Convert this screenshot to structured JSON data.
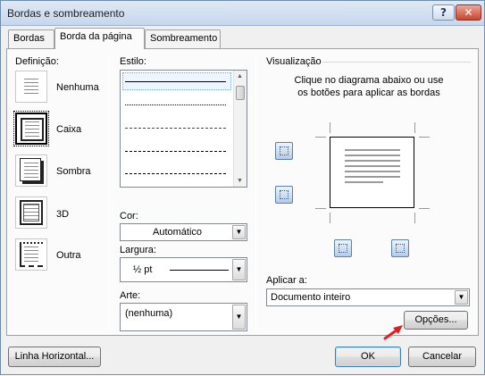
{
  "window": {
    "title": "Bordas e sombreamento",
    "help_glyph": "?",
    "close_glyph": "✕"
  },
  "tabs": [
    {
      "label": "Bordas",
      "active": false
    },
    {
      "label": "Borda da página",
      "active": true
    },
    {
      "label": "Sombreamento",
      "active": false
    }
  ],
  "setting": {
    "label": "Definição:",
    "items": [
      {
        "label": "Nenhuma",
        "icon": "none-border-icon",
        "selected": false
      },
      {
        "label": "Caixa",
        "icon": "box-border-icon",
        "selected": true
      },
      {
        "label": "Sombra",
        "icon": "shadow-border-icon",
        "selected": false
      },
      {
        "label": "3D",
        "icon": "3d-border-icon",
        "selected": false
      },
      {
        "label": "Outra",
        "icon": "custom-border-icon",
        "selected": false
      }
    ]
  },
  "style": {
    "label": "Estilo:",
    "options": [
      "solid",
      "dotted",
      "dash-dot-small",
      "dashed",
      "dashed-long"
    ]
  },
  "color": {
    "label": "Cor:",
    "value": "Automático"
  },
  "width": {
    "label": "Largura:",
    "value": "½ pt"
  },
  "art": {
    "label": "Arte:",
    "value": "(nenhuma)"
  },
  "preview": {
    "label": "Visualização",
    "hint": "Clique no diagrama abaixo ou use os botões para aplicar as bordas"
  },
  "apply_to": {
    "label": "Aplicar a:",
    "value": "Documento inteiro"
  },
  "buttons": {
    "options": "Opções...",
    "horizontal_line": "Linha Horizontal...",
    "ok": "OK",
    "cancel": "Cancelar"
  },
  "colors": {
    "accent": "#3c7fb1",
    "annotation_arrow": "#e02020"
  }
}
